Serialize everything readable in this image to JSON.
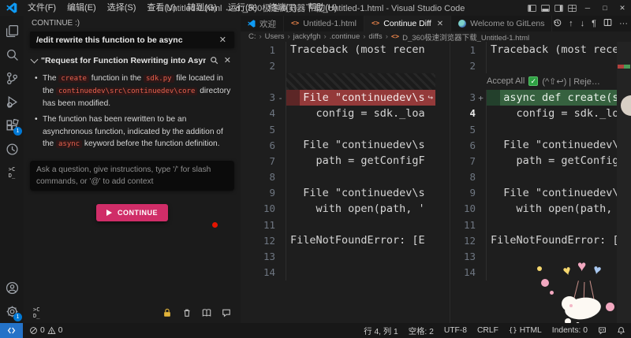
{
  "window": {
    "title": "Untitled-1.html ↔ d:_360极速浏览器下载_Untitled-1.html - Visual Studio Code",
    "menus": [
      "文件(F)",
      "编辑(E)",
      "选择(S)",
      "查看(V)",
      "转到(G)",
      "运行(R)",
      "终端(T)",
      "帮助(H)"
    ],
    "controls": {
      "minimize": "─",
      "maximize": "□",
      "close": "✕"
    }
  },
  "activity_bar": {
    "icons": [
      "explorer-icon",
      "search-icon",
      "source-control-icon",
      "run-debug-icon",
      "extensions-icon",
      "history-clock-icon",
      "continue-icon",
      "account-icon",
      "settings-gear-icon"
    ],
    "extensions_badge": "1",
    "settings_badge": "1",
    "continue_logo": ">C\nD_"
  },
  "sidebar": {
    "title": "CONTINUE :)",
    "prompt": "/edit rewrite this function to be async",
    "section_title": "\"Request for Function Rewriting into Asynchronous Mode\"",
    "bullets": [
      [
        {
          "t": "text",
          "v": "The "
        },
        {
          "t": "code",
          "v": "create"
        },
        {
          "t": "text",
          "v": " function in the "
        },
        {
          "t": "code",
          "v": "sdk.py"
        },
        {
          "t": "text",
          "v": " file located in the "
        },
        {
          "t": "code",
          "v": "continuedev\\src\\continuedev\\core"
        },
        {
          "t": "text",
          "v": " directory has been modified."
        }
      ],
      [
        {
          "t": "text",
          "v": "The function has been rewritten to be an asynchronous function, indicated by the addition of the "
        },
        {
          "t": "code",
          "v": "async"
        },
        {
          "t": "text",
          "v": " keyword before the function definition."
        }
      ]
    ],
    "input_placeholder": "Ask a question, give instructions, type '/' for slash commands, or '@' to add context",
    "continue_button": "CONTINUE",
    "footer_logo": ">C\nD_"
  },
  "editor": {
    "tabs": [
      {
        "icon": "vscode",
        "label": "欢迎",
        "active": false,
        "close": false
      },
      {
        "icon": "html",
        "label": "Untitled-1.html",
        "active": false,
        "close": false
      },
      {
        "icon": "html",
        "label": "Continue Diff",
        "active": true,
        "close": true
      },
      {
        "icon": "gitlens",
        "label": "Welcome to GitLens",
        "active": false,
        "close": false
      }
    ],
    "actions": [
      "history",
      "arrow-up",
      "arrow-down",
      "pilcrow",
      "split-editor",
      "more"
    ],
    "breadcrumb": [
      "C:",
      "Users",
      "jackyfgh",
      ".continue",
      "diffs"
    ],
    "breadcrumb_file": "D_360极速浏览器下载_Untitled-1.html",
    "codelens": {
      "accept": "Accept All",
      "check": "✓",
      "rest": "(^⇧↩) | Reje…"
    },
    "diff": {
      "left": [
        {
          "n": "1",
          "text": "Traceback (most recen"
        },
        {
          "n": "2",
          "text": ""
        },
        {
          "type": "hatch"
        },
        {
          "n": "3",
          "sign": "-",
          "mark": "removed",
          "arrow": "↪",
          "text": "  File \"continuedev\\s"
        },
        {
          "n": "4",
          "text": "    config = sdk._loa"
        },
        {
          "n": "5",
          "text": ""
        },
        {
          "n": "6",
          "text": "  File \"continuedev\\s"
        },
        {
          "n": "7",
          "text": "    path = getConfigF"
        },
        {
          "n": "8",
          "text": ""
        },
        {
          "n": "9",
          "text": "  File \"continuedev\\s"
        },
        {
          "n": "10",
          "text": "    with open(path, '"
        },
        {
          "n": "11",
          "text": "",
          "breakpoint": true
        },
        {
          "n": "12",
          "text": "FileNotFoundError: [E"
        },
        {
          "n": "13",
          "text": ""
        },
        {
          "n": "14",
          "text": ""
        }
      ],
      "right": [
        {
          "n": "1",
          "text": "Traceback (most recen"
        },
        {
          "n": "2",
          "text": ""
        },
        {
          "type": "codelens"
        },
        {
          "n": "3",
          "sign": "+",
          "mark": "added",
          "text": "  async def create(se"
        },
        {
          "n": "4",
          "text": "    config = sdk._loa",
          "current": true
        },
        {
          "n": "5",
          "text": ""
        },
        {
          "n": "6",
          "text": "  File \"continuedev\\s"
        },
        {
          "n": "7",
          "text": "    path = getConfigF"
        },
        {
          "n": "8",
          "text": ""
        },
        {
          "n": "9",
          "text": "  File \"continuedev\\s"
        },
        {
          "n": "10",
          "text": "    with open(path, '"
        },
        {
          "n": "11",
          "text": ""
        },
        {
          "n": "12",
          "text": "FileNotFoundError: [E"
        },
        {
          "n": "13",
          "text": ""
        },
        {
          "n": "14",
          "text": ""
        }
      ]
    }
  },
  "status_bar": {
    "errors": "0",
    "warnings": "0",
    "segments": [
      {
        "text": "行 4, 列 1"
      },
      {
        "text": "空格: 2"
      },
      {
        "text": "UTF-8"
      },
      {
        "text": "CRLF"
      },
      {
        "text": "HTML",
        "icon": "braces"
      },
      {
        "text": "Indents: 0"
      }
    ]
  },
  "colors": {
    "accent_pink": "#d02d68",
    "diff_removed": "#943a3a",
    "diff_added": "#36613f",
    "badge_blue": "#0078d4",
    "remote_blue": "#2472c8",
    "check_green": "#2ea043"
  }
}
